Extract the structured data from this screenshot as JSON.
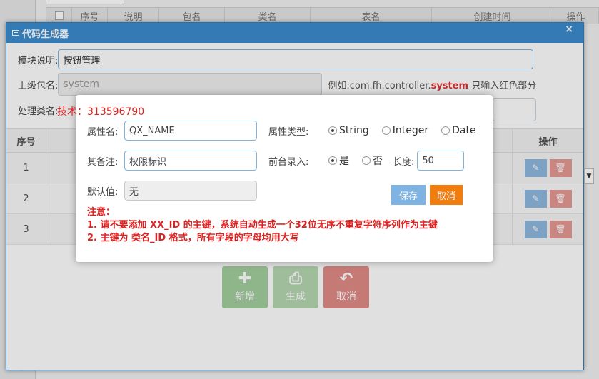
{
  "background": {
    "columns": [
      "",
      "序号",
      "说明",
      "包名",
      "类名",
      "表名",
      "创建时间",
      "操作"
    ]
  },
  "dialog": {
    "title": "代码生成器",
    "close": "×",
    "module_label": "模块说明:",
    "module_value": "按钮管理",
    "package_label": "上级包名:",
    "package_value": "system",
    "example_prefix": "例如:com.fh.controller.",
    "example_red": "system",
    "example_suffix": " 只输入红色部分",
    "class_label": "处理类名:",
    "table": {
      "col_no": "序号",
      "col_op": "操作",
      "rows": [
        {
          "no": "1"
        },
        {
          "no": "2"
        },
        {
          "no": "3"
        }
      ]
    },
    "buttons": {
      "add": "新增",
      "generate": "生成",
      "cancel": "取消"
    }
  },
  "watermark": "技术：313596790",
  "modal": {
    "attr_name_label": "属性名:",
    "attr_name_value": "QX_NAME",
    "attr_type_label": "属性类型:",
    "types": [
      "String",
      "Integer",
      "Date"
    ],
    "type_selected": "String",
    "remark_label": "其备注:",
    "remark_value": "权限标识",
    "front_label": "前台录入:",
    "front_yes": "是",
    "front_no": "否",
    "front_selected": "是",
    "length_label": "长度:",
    "length_value": "50",
    "default_label": "默认值:",
    "default_value": "无",
    "save": "保存",
    "cancel": "取消",
    "note_title": "注意：",
    "note_1": "1. 请不要添加 XX_ID 的主键，系统自动生成一个32位无序不重复字符序列作为主键",
    "note_2": "2. 主键为 类名_ID 格式，所有字段的字母均用大写"
  }
}
